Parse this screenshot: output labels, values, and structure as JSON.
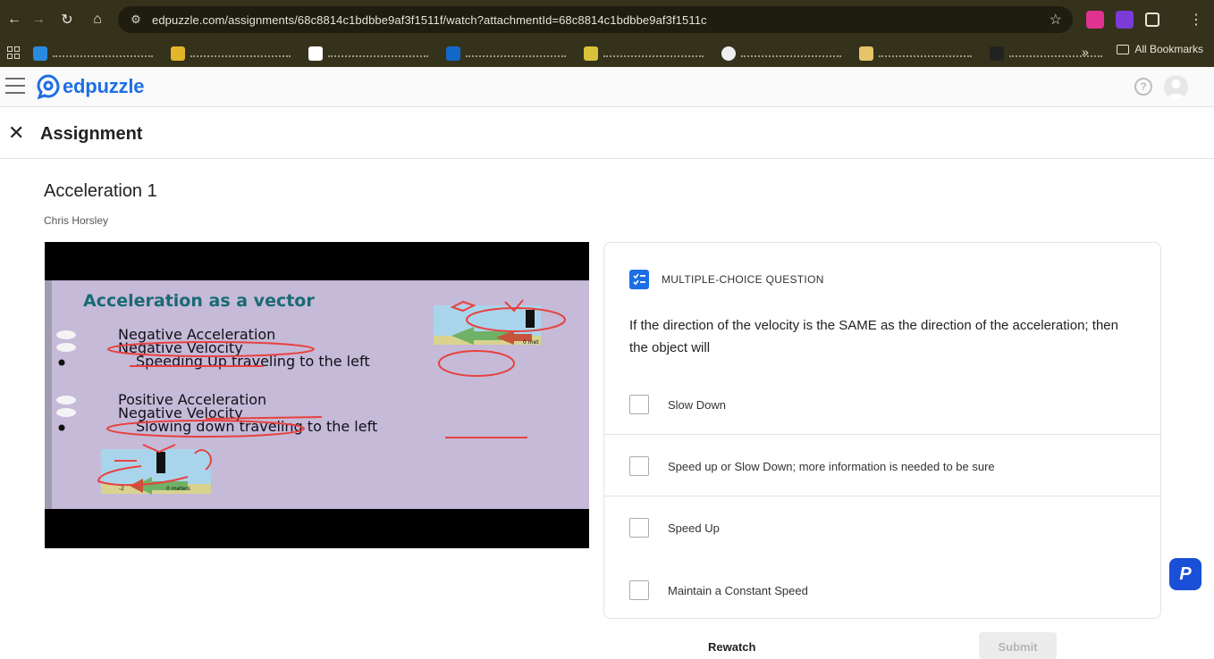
{
  "browser": {
    "url": "edpuzzle.com/assignments/68c8814c1bdbbe9af3f1511f/watch?attachmentId=68c8814c1bdbbe9af3f1511c",
    "all_bookmarks_label": "All Bookmarks"
  },
  "app": {
    "logo_text": "edpuzzle",
    "help_symbol": "?"
  },
  "assignment_bar": {
    "title": "Assignment"
  },
  "lesson": {
    "title": "Acceleration 1",
    "teacher": "Chris Horsley"
  },
  "video_slide": {
    "heading": "Acceleration as a vector",
    "lines_group1": [
      "Negative Acceleration",
      "Negative Velocity",
      "Speeding Up traveling to the left"
    ],
    "lines_group2": [
      "Positive Acceleration",
      "Negative Velocity",
      "Slowing down traveling to the left"
    ],
    "diagram_labels": {
      "top": "0 met",
      "bottom": "0 meters",
      "minus_two": "-2"
    }
  },
  "question": {
    "type_label": "MULTIPLE-CHOICE QUESTION",
    "text": "If the direction of the velocity is the SAME as the direction of the acceleration; then the object will",
    "options": [
      "Slow Down",
      "Speed up or Slow Down; more information is needed to be sure",
      "Speed Up",
      "Maintain a Constant Speed"
    ]
  },
  "footer": {
    "rewatch_label": "Rewatch",
    "submit_label": "Submit"
  },
  "colors": {
    "brand": "#1d6ee4",
    "chrome": "#35321b"
  }
}
